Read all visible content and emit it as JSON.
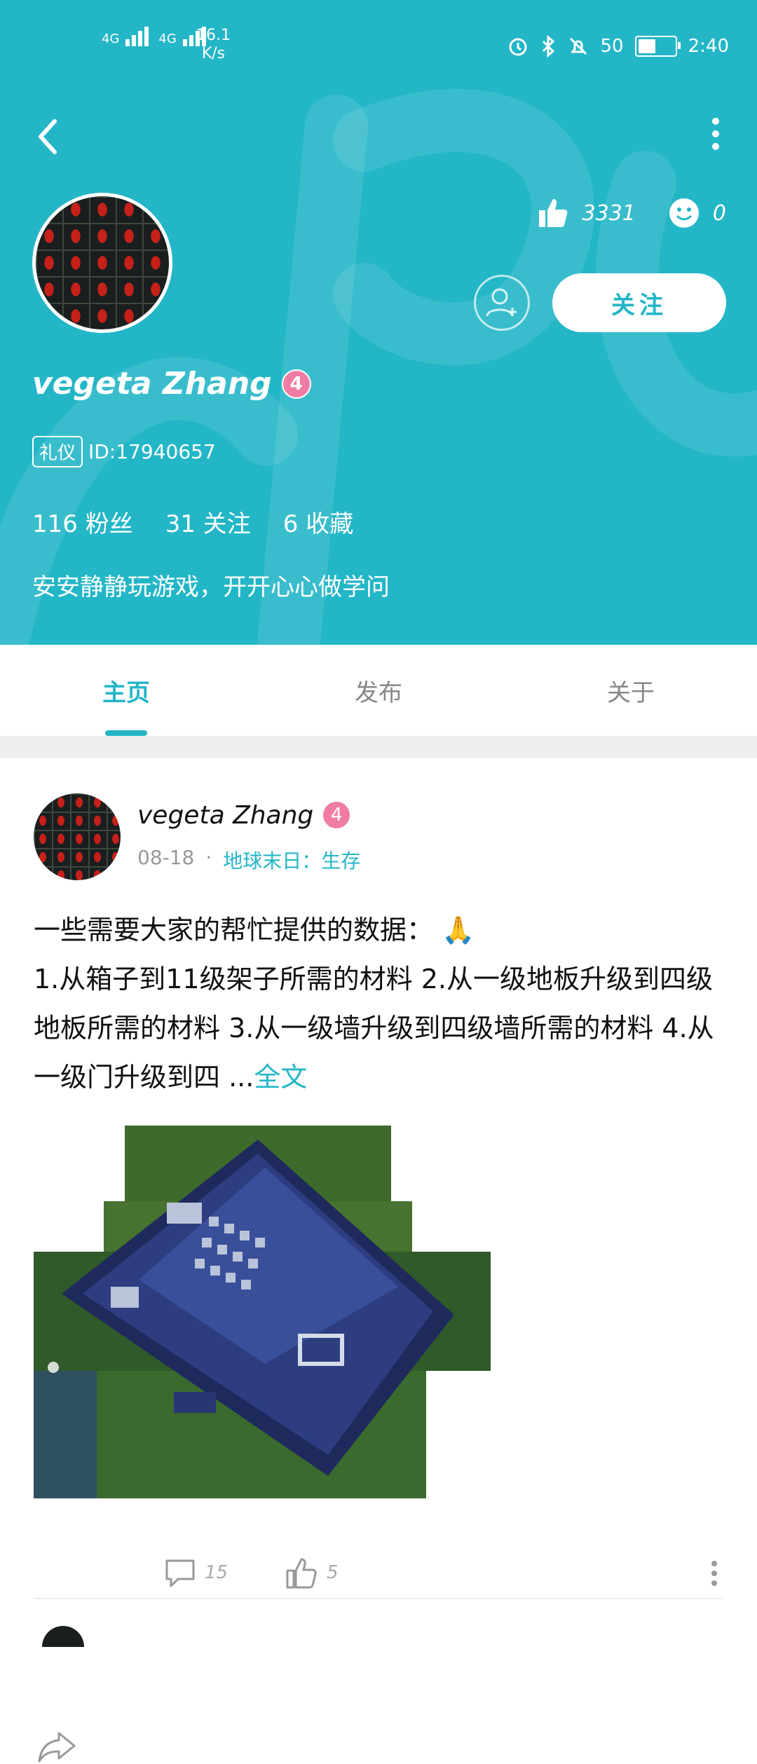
{
  "status_bar": {
    "net1": "4G",
    "net2": "4G",
    "speed_value": "16.1",
    "speed_unit": "K/s",
    "battery": "50",
    "time": "2:40"
  },
  "profile": {
    "name": "vegeta Zhang",
    "level": "4",
    "tag": "礼仪",
    "id_text": "ID:17940657",
    "likes": "3331",
    "smiles": "0",
    "follow_label": "关注",
    "fans": "116 粉丝",
    "following": "31 关注",
    "favorites": "6 收藏",
    "bio": "安安静静玩游戏，开开心心做学问"
  },
  "tabs": [
    "主页",
    "发布",
    "关于"
  ],
  "post": {
    "author": "vegeta Zhang",
    "level": "4",
    "date": "08-18",
    "dot": "·",
    "category": "地球末日：生存",
    "line1": "一些需要大家的帮忙提供的数据： 🙏",
    "body": "1.从箱子到11级架子所需的材料 2.从一级地板升级到四级地板所需的材料 3.从一级墙升级到四级墙所需的材料 4.从一级门升级到四 ...",
    "more": "全文",
    "comments": "15",
    "likes": "5"
  },
  "colors": {
    "accent": "#23b6c7",
    "level_badge": "#f07ca5"
  }
}
